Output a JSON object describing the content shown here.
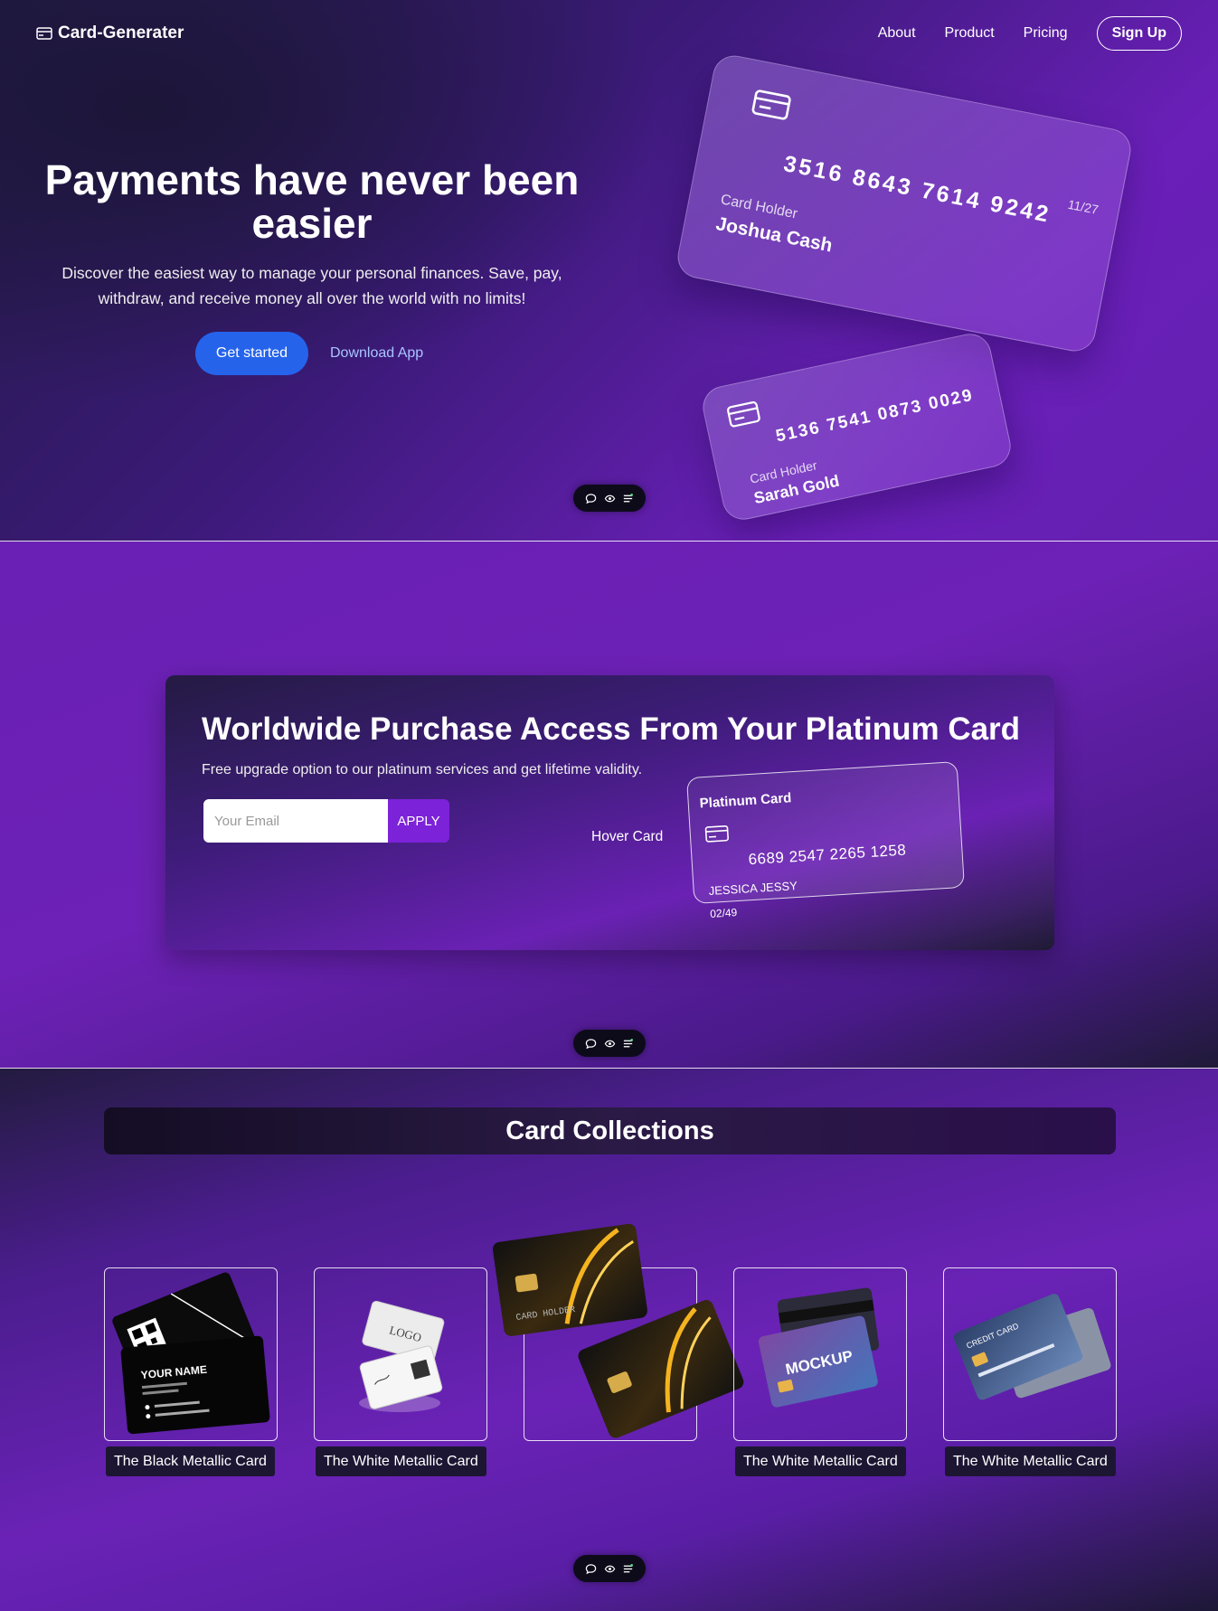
{
  "nav": {
    "logo": "Card-Generater",
    "links": [
      "About",
      "Product",
      "Pricing"
    ],
    "signup": "Sign Up"
  },
  "hero": {
    "title": "Payments have never been easier",
    "subtitle": "Discover the easiest way to manage your personal finances. Save, pay, withdraw, and receive money all over the world with no limits!",
    "cta_primary": "Get started",
    "cta_secondary": "Download App",
    "card1": {
      "number": "3516 8643 7614 9242",
      "expiry": "11/27",
      "holder_label": "Card Holder",
      "holder": "Joshua Cash"
    },
    "card2": {
      "number": "5136 7541 0873 0029",
      "holder_label": "Card Holder",
      "holder": "Sarah Gold"
    }
  },
  "promo": {
    "title": "Worldwide Purchase Access From Your Platinum Card",
    "subtitle": "Free upgrade option to our platinum services and get lifetime validity.",
    "email_placeholder": "Your Email",
    "apply": "APPLY",
    "hover_label": "Hover Card",
    "card": {
      "title": "Platinum Card",
      "number": "6689 2547 2265 1258",
      "holder": "JESSICA JESSY",
      "expiry": "02/49"
    }
  },
  "collections": {
    "title": "Card Collections",
    "items": [
      {
        "label": "The Black Metallic Card",
        "art": "black-business-card",
        "name_text": "YOUR NAME"
      },
      {
        "label": "The White Metallic Card",
        "art": "white-business-card",
        "name_text": "LOGO"
      },
      {
        "label": "",
        "art": "gold-wave-cards",
        "name_text": "CARD HOLDER"
      },
      {
        "label": "The White Metallic Card",
        "art": "mockup-cards",
        "name_text": "MOCKUP"
      },
      {
        "label": "The White Metallic Card",
        "art": "blue-credit-cards",
        "name_text": "CREDIT CARD"
      }
    ]
  },
  "toolbar_icons": [
    "comment-icon",
    "eye-icon",
    "menu-lines-icon"
  ]
}
